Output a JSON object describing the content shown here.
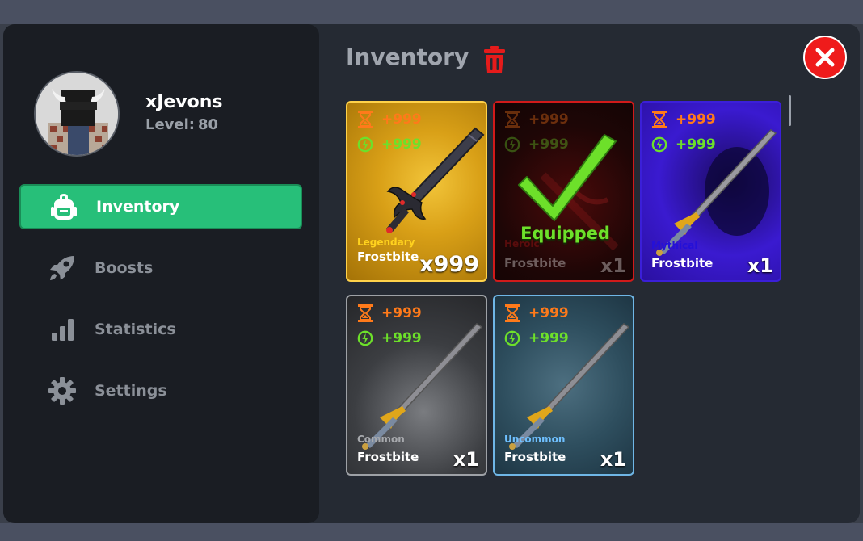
{
  "profile": {
    "username": "xJevons",
    "level_label": "Level:",
    "level_value": "80"
  },
  "nav": {
    "items": [
      {
        "label": "Inventory",
        "icon": "backpack-icon",
        "active": true
      },
      {
        "label": "Boosts",
        "icon": "rocket-icon",
        "active": false
      },
      {
        "label": "Statistics",
        "icon": "bar-chart-icon",
        "active": false
      },
      {
        "label": "Settings",
        "icon": "gear-icon",
        "active": false
      }
    ]
  },
  "main": {
    "title": "Inventory",
    "trash_icon": "trash-icon",
    "close_icon": "close-icon"
  },
  "inventory": {
    "items": [
      {
        "rarity": "Legendary",
        "name": "Frostbite",
        "time_bonus": "+999",
        "power_bonus": "+999",
        "quantity": "x999",
        "equipped": false,
        "rarity_color": "#ffd21e"
      },
      {
        "rarity": "Heroic",
        "name": "Frostbite",
        "time_bonus": "+999",
        "power_bonus": "+999",
        "quantity": "x1",
        "equipped": true,
        "equipped_label": "Equipped",
        "rarity_color": "#c31818"
      },
      {
        "rarity": "Mythical",
        "name": "Frostbite",
        "time_bonus": "+999",
        "power_bonus": "+999",
        "quantity": "x1",
        "equipped": false,
        "rarity_color": "#2410d8"
      },
      {
        "rarity": "Common",
        "name": "Frostbite",
        "time_bonus": "+999",
        "power_bonus": "+999",
        "quantity": "x1",
        "equipped": false,
        "rarity_color": "#a7a9ad"
      },
      {
        "rarity": "Uncommon",
        "name": "Frostbite",
        "time_bonus": "+999",
        "power_bonus": "+999",
        "quantity": "x1",
        "equipped": false,
        "rarity_color": "#6fc0ff"
      }
    ]
  },
  "colors": {
    "accent_green": "#27bf79",
    "close_red": "#ef1b1b",
    "time_orange": "#ff7a1a",
    "power_green": "#6de02a"
  }
}
